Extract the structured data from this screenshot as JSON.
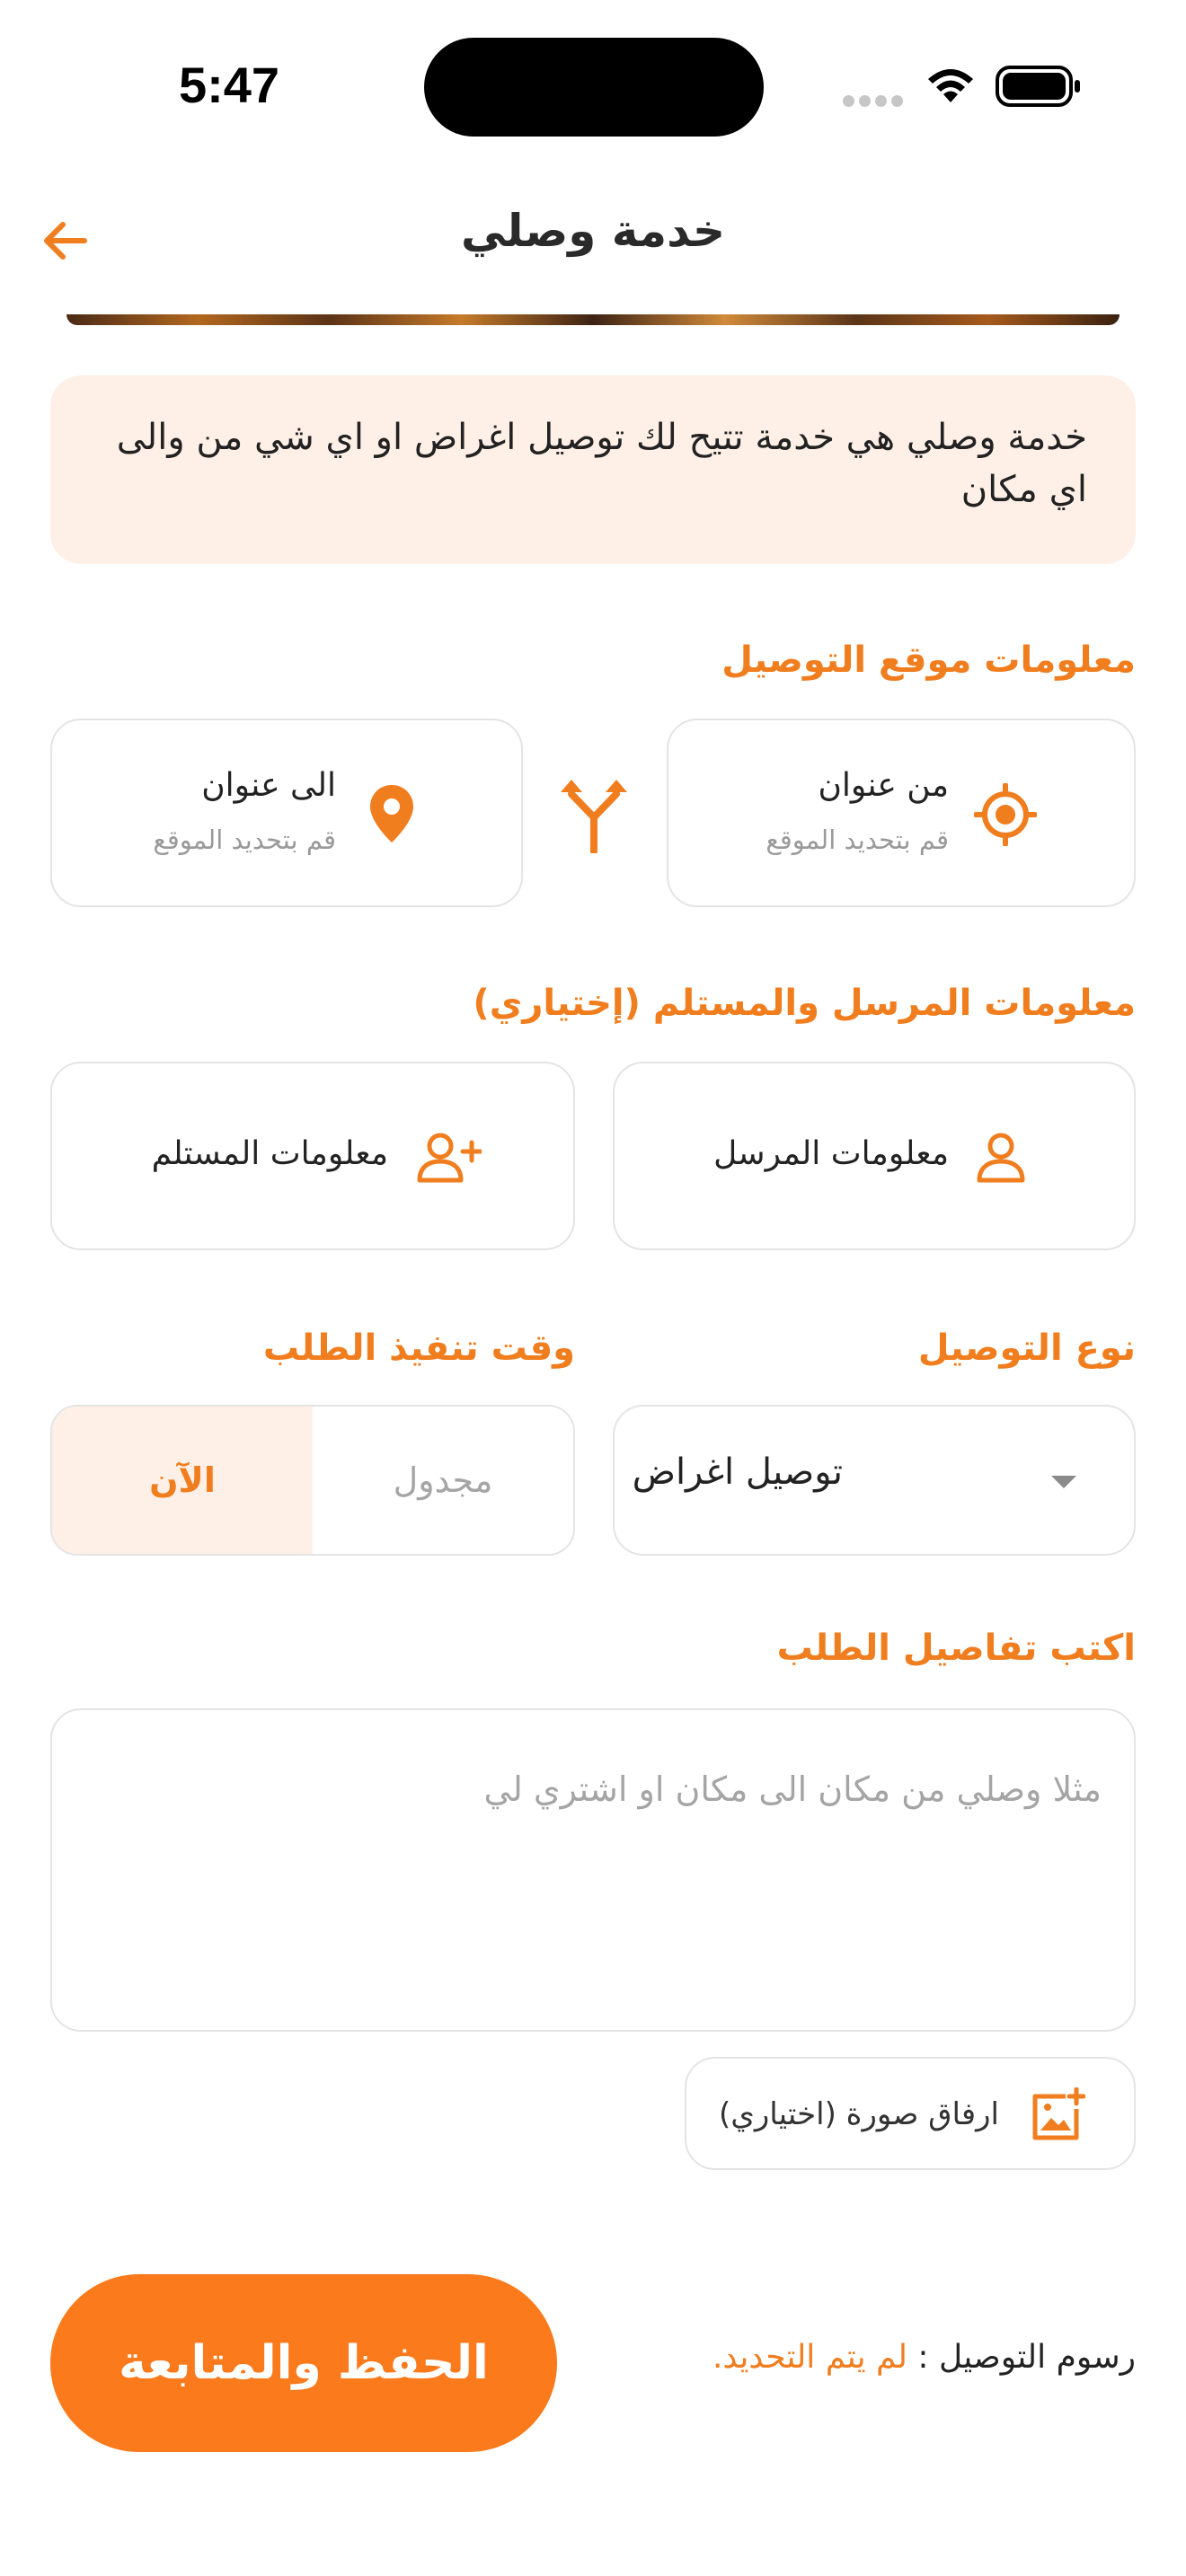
{
  "status_bar": {
    "time": "5:47"
  },
  "header": {
    "title": "خدمة وصلي"
  },
  "info": {
    "text": "خدمة وصلي هي خدمة تتيح لك توصيل اغراض او اي شي من والى اي مكان"
  },
  "location": {
    "section_title": "معلومات موقع التوصيل",
    "from": {
      "label": "من عنوان",
      "hint": "قم بتحديد الموقع"
    },
    "to": {
      "label": "الى عنوان",
      "hint": "قم بتحديد الموقع"
    }
  },
  "people": {
    "section_title": "معلومات المرسل والمستلم (إختياري)",
    "sender": "معلومات المرسل",
    "receiver": "معلومات المستلم"
  },
  "delivery_type": {
    "label": "نوع التوصيل",
    "value": "توصيل اغراض"
  },
  "timing": {
    "label": "وقت تنفيذ الطلب",
    "now": "الآن",
    "scheduled": "مجدول"
  },
  "details": {
    "label": "اكتب تفاصيل الطلب",
    "placeholder": "مثلا وصلي من مكان الى مكان او اشتري لي"
  },
  "attach": {
    "label": "ارفاق صورة (اختياري)"
  },
  "footer": {
    "fee_label": "رسوم التوصيل :",
    "fee_value": "لم يتم التحديد.",
    "save_label": "الحفظ والمتابعة"
  },
  "colors": {
    "accent": "#f07d1e",
    "accent_light": "#fef0e7",
    "button": "#fb7a1c"
  },
  "icons": [
    "back-arrow-icon",
    "target-icon",
    "map-pin-icon",
    "swap-route-icon",
    "user-icon",
    "user-plus-icon",
    "chevron-down-icon",
    "image-add-icon",
    "wifi-icon",
    "battery-icon"
  ]
}
